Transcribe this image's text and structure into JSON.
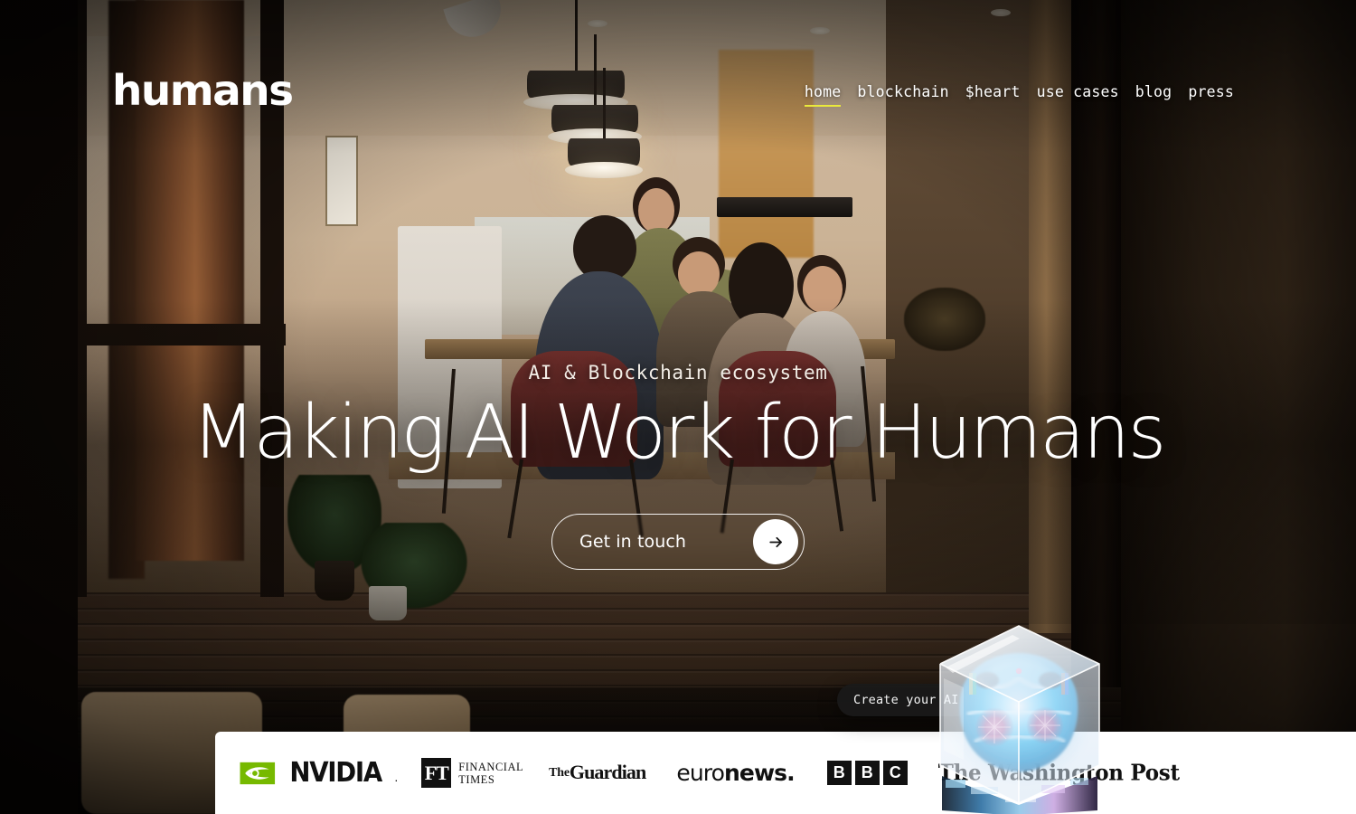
{
  "brand": {
    "logo_text": "humans"
  },
  "nav": {
    "items": [
      {
        "label": "home",
        "active": true
      },
      {
        "label": "blockchain",
        "active": false
      },
      {
        "label": "$heart",
        "active": false
      },
      {
        "label": "use cases",
        "active": false
      },
      {
        "label": "blog",
        "active": false
      },
      {
        "label": "press",
        "active": false
      }
    ],
    "active_underline_color": "#e9e93c"
  },
  "hero": {
    "eyebrow": "AI & Blockchain ecosystem",
    "headline": "Making AI Work for Humans",
    "cta_label": "Get in touch",
    "cta_arrow_icon": "arrow-right-icon"
  },
  "floating": {
    "create_pill_label": "Create your AI >",
    "cube_icon": "ai-glass-cube-icon"
  },
  "logo_bar": {
    "brands": [
      {
        "name": "NVIDIA",
        "wordmark": "NVIDIA",
        "dot": ".",
        "icon": "nvidia-eye-icon"
      },
      {
        "name": "Financial Times",
        "mark": "FT",
        "line1": "FINANCIAL",
        "line2": "TIMES"
      },
      {
        "name": "The Guardian",
        "line1": "The",
        "line2": "Guardian"
      },
      {
        "name": "euronews",
        "light": "euro",
        "bold": "news."
      },
      {
        "name": "BBC",
        "letters": [
          "B",
          "B",
          "C"
        ]
      },
      {
        "name": "The Washington Post",
        "wordmark": "The Washington Post"
      }
    ]
  }
}
